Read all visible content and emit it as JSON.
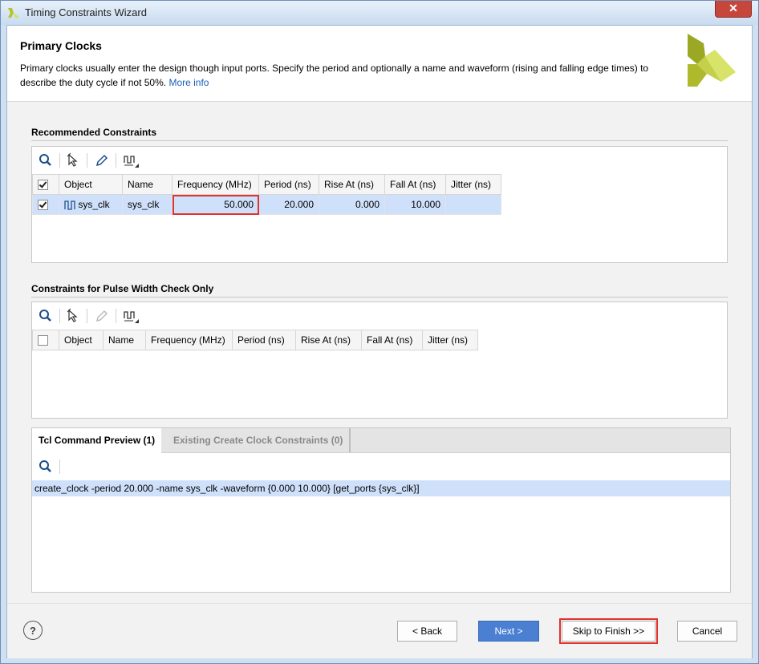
{
  "window": {
    "title": "Timing Constraints Wizard",
    "close_label": "✕"
  },
  "header": {
    "title": "Primary Clocks",
    "description": "Primary clocks usually enter the design though input ports. Specify the period and optionally a name and waveform (rising and falling edge times) to describe the duty cycle if not 50%.",
    "more_info": "More info"
  },
  "recommended": {
    "label": "Recommended Constraints",
    "columns": [
      "Object",
      "Name",
      "Frequency (MHz)",
      "Period (ns)",
      "Rise At (ns)",
      "Fall At (ns)",
      "Jitter (ns)"
    ],
    "rows": [
      {
        "checked": true,
        "object": "sys_clk",
        "name": "sys_clk",
        "frequency": "50.000",
        "period": "20.000",
        "rise_at": "0.000",
        "fall_at": "10.000",
        "jitter": ""
      }
    ]
  },
  "pulse_width": {
    "label": "Constraints for Pulse Width Check Only",
    "columns": [
      "Object",
      "Name",
      "Frequency (MHz)",
      "Period (ns)",
      "Rise At (ns)",
      "Fall At (ns)",
      "Jitter (ns)"
    ]
  },
  "preview": {
    "tabs": [
      {
        "label": "Tcl Command Preview (1)",
        "active": true
      },
      {
        "label": "Existing Create Clock Constraints (0)",
        "active": false
      }
    ],
    "command": "create_clock -period 20.000 -name sys_clk -waveform {0.000 10.000} [get_ports {sys_clk}]"
  },
  "footer": {
    "help": "?",
    "back": "< Back",
    "next": "Next >",
    "skip": "Skip to Finish >>",
    "cancel": "Cancel"
  },
  "colors": {
    "accent": "#4a7fd2",
    "highlight": "#e0332e",
    "selection": "#cfe0fb",
    "logo_green": "#a8b82a"
  }
}
